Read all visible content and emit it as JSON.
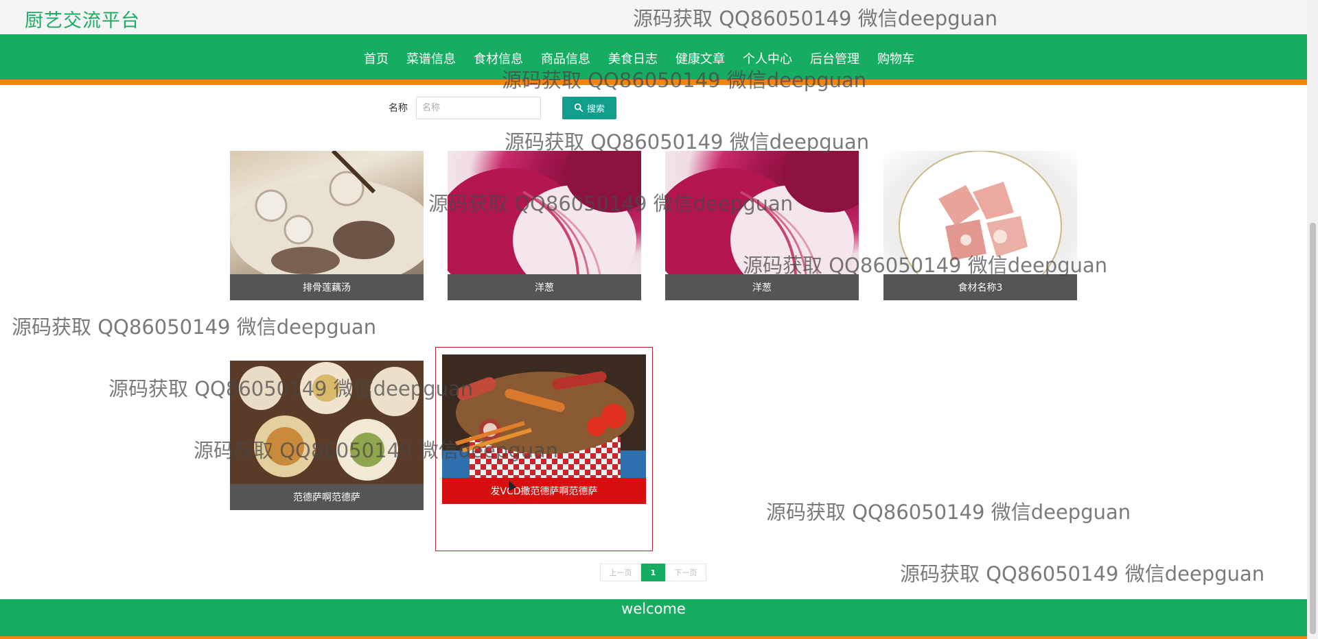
{
  "site_title": "厨艺交流平台",
  "nav": {
    "items": [
      "首页",
      "菜谱信息",
      "食材信息",
      "商品信息",
      "美食日志",
      "健康文章",
      "个人中心",
      "后台管理",
      "购物车"
    ]
  },
  "search": {
    "label": "名称",
    "placeholder": "名称",
    "value": "",
    "button_label": "搜索"
  },
  "cards": [
    {
      "caption": "排骨莲藕汤",
      "image": "pork-rib-lotus-soup"
    },
    {
      "caption": "洋葱",
      "image": "red-onion"
    },
    {
      "caption": "洋葱",
      "image": "red-onion"
    },
    {
      "caption": "食材名称3",
      "image": "raw-meat-plate"
    },
    {
      "caption": "范德萨啊范德萨",
      "image": "assorted-dishes"
    },
    {
      "caption": "发VCD撒范德萨啊范德萨",
      "image": "sausage-platter"
    }
  ],
  "pagination": {
    "prev": "上一页",
    "current": "1",
    "next": "下一页"
  },
  "footer": {
    "text": "welcome"
  },
  "watermark": {
    "text": "源码获取 QQ86050149 微信deepguan"
  },
  "colors": {
    "brand_green": "#16ad62",
    "accent_orange": "#f0850f",
    "search_button": "#129d8c",
    "caption_gray": "#555555",
    "caption_active_red": "#d60f0f"
  }
}
